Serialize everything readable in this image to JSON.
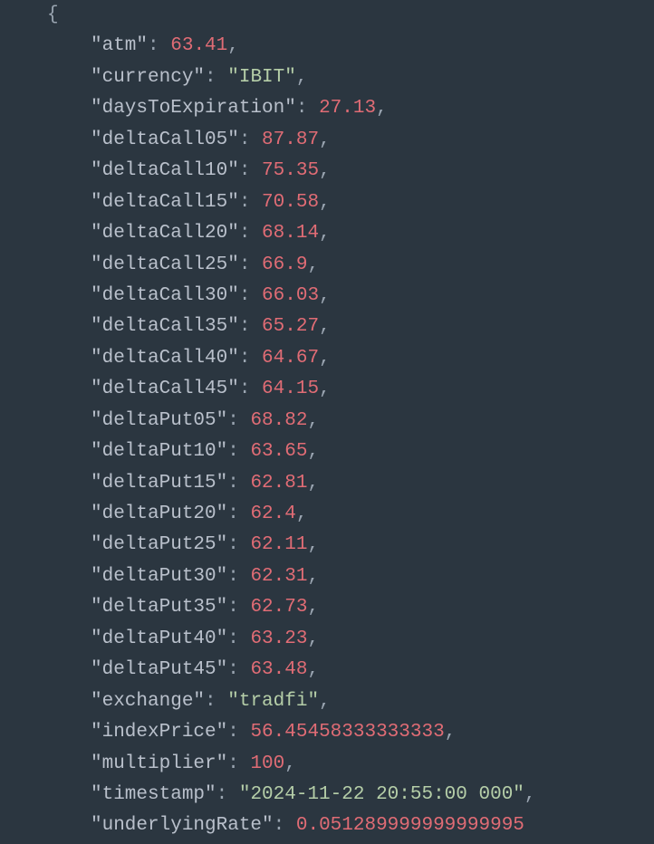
{
  "json_display": {
    "open_brace": "{",
    "entries": [
      {
        "key": "\"atm\"",
        "value": "63.41",
        "type": "number"
      },
      {
        "key": "\"currency\"",
        "value": "\"IBIT\"",
        "type": "string"
      },
      {
        "key": "\"daysToExpiration\"",
        "value": "27.13",
        "type": "number"
      },
      {
        "key": "\"deltaCall05\"",
        "value": "87.87",
        "type": "number"
      },
      {
        "key": "\"deltaCall10\"",
        "value": "75.35",
        "type": "number"
      },
      {
        "key": "\"deltaCall15\"",
        "value": "70.58",
        "type": "number"
      },
      {
        "key": "\"deltaCall20\"",
        "value": "68.14",
        "type": "number"
      },
      {
        "key": "\"deltaCall25\"",
        "value": "66.9",
        "type": "number"
      },
      {
        "key": "\"deltaCall30\"",
        "value": "66.03",
        "type": "number"
      },
      {
        "key": "\"deltaCall35\"",
        "value": "65.27",
        "type": "number"
      },
      {
        "key": "\"deltaCall40\"",
        "value": "64.67",
        "type": "number"
      },
      {
        "key": "\"deltaCall45\"",
        "value": "64.15",
        "type": "number"
      },
      {
        "key": "\"deltaPut05\"",
        "value": "68.82",
        "type": "number"
      },
      {
        "key": "\"deltaPut10\"",
        "value": "63.65",
        "type": "number"
      },
      {
        "key": "\"deltaPut15\"",
        "value": "62.81",
        "type": "number"
      },
      {
        "key": "\"deltaPut20\"",
        "value": "62.4",
        "type": "number"
      },
      {
        "key": "\"deltaPut25\"",
        "value": "62.11",
        "type": "number"
      },
      {
        "key": "\"deltaPut30\"",
        "value": "62.31",
        "type": "number"
      },
      {
        "key": "\"deltaPut35\"",
        "value": "62.73",
        "type": "number"
      },
      {
        "key": "\"deltaPut40\"",
        "value": "63.23",
        "type": "number"
      },
      {
        "key": "\"deltaPut45\"",
        "value": "63.48",
        "type": "number"
      },
      {
        "key": "\"exchange\"",
        "value": "\"tradfi\"",
        "type": "string"
      },
      {
        "key": "\"indexPrice\"",
        "value": "56.45458333333333",
        "type": "number"
      },
      {
        "key": "\"multiplier\"",
        "value": "100",
        "type": "number"
      },
      {
        "key": "\"timestamp\"",
        "value": "\"2024-11-22 20:55:00 000\"",
        "type": "string"
      },
      {
        "key": "\"underlyingRate\"",
        "value": "0.051289999999999995",
        "type": "number",
        "last": true
      }
    ]
  }
}
